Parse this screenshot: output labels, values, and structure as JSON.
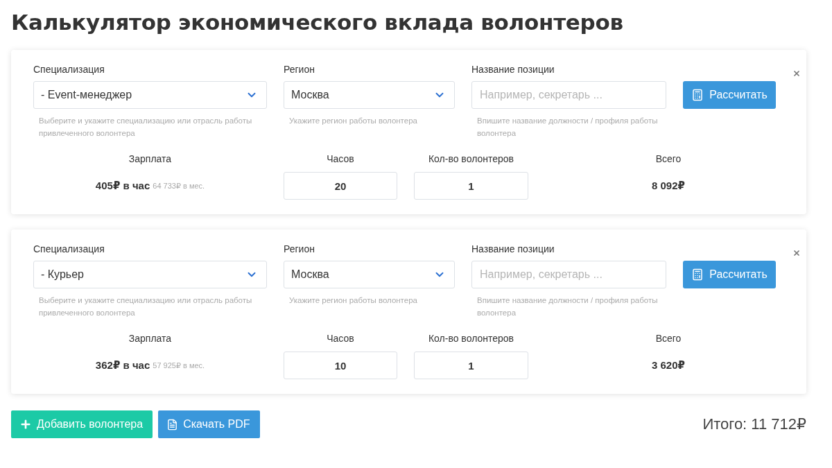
{
  "title": "Калькулятор экономического вклада волонтеров",
  "volunteers": [
    {
      "specialization": {
        "label": "Специализация",
        "value": "- Event-менеджер",
        "hint": "Выберите и укажите специализацию или отрасль работы привлеченного волонтера"
      },
      "region": {
        "label": "Регион",
        "value": "Москва",
        "hint": "Укажите регион работы волонтера"
      },
      "position": {
        "label": "Название позиции",
        "placeholder": "Например, секретарь ...",
        "hint": "Впишите название должности / профиля работы волонтера"
      },
      "calculate": "Рассчитать",
      "salary": {
        "label": "Зарплата",
        "hourly": "405₽ в час",
        "monthly": "64 733₽ в мес."
      },
      "hours": {
        "label": "Часов",
        "value": "20"
      },
      "count": {
        "label": "Кол-во волонтеров",
        "value": "1"
      },
      "total": {
        "label": "Всего",
        "value": "8 092₽"
      }
    },
    {
      "specialization": {
        "label": "Специализация",
        "value": "- Курьер",
        "hint": "Выберите и укажите специализацию или отрасль работы привлеченного волонтера"
      },
      "region": {
        "label": "Регион",
        "value": "Москва",
        "hint": "Укажите регион работы волонтера"
      },
      "position": {
        "label": "Название позиции",
        "placeholder": "Например, секретарь ...",
        "hint": "Впишите название должности / профиля работы волонтера"
      },
      "calculate": "Рассчитать",
      "salary": {
        "label": "Зарплата",
        "hourly": "362₽ в час",
        "monthly": "57 925₽ в мес."
      },
      "hours": {
        "label": "Часов",
        "value": "10"
      },
      "count": {
        "label": "Кол-во волонтеров",
        "value": "1"
      },
      "total": {
        "label": "Всего",
        "value": "3 620₽"
      }
    }
  ],
  "actions": {
    "add": "Добавить волонтера",
    "pdf": "Скачать PDF"
  },
  "grand_total": "Итого: 11 712₽"
}
